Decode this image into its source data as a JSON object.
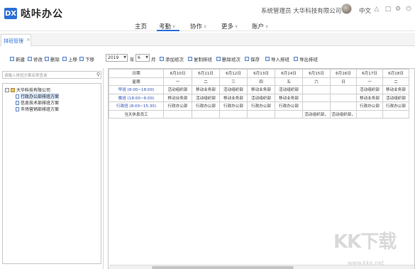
{
  "app": {
    "logo_mark": "DX",
    "title": "哒咔办公"
  },
  "header": {
    "user_role": "系统管理员 大华科技有限公司",
    "language": "中文",
    "nav": [
      {
        "label": "主页",
        "has_menu": false
      },
      {
        "label": "考勤",
        "has_menu": true,
        "active": true
      },
      {
        "label": "协作",
        "has_menu": true
      },
      {
        "label": "更多",
        "has_menu": true
      },
      {
        "label": "账户",
        "has_menu": true
      }
    ],
    "icons": [
      "bell-icon",
      "shirt-icon",
      "settings-icon",
      "power-icon"
    ],
    "accent": "#2b6fd6"
  },
  "tabs": [
    {
      "label": "排班管理",
      "close": "×"
    }
  ],
  "toolbar": {
    "left": [
      "新建",
      "修改",
      "删除",
      "上移",
      "下移"
    ],
    "year": "2019",
    "month": "6",
    "month_unit": "月",
    "actions": [
      "添加班次",
      "复制排班",
      "删除班次",
      "保存",
      "导入排班",
      "导出排班"
    ]
  },
  "search": {
    "placeholder": "请输入排班方案名称查询"
  },
  "tree": {
    "root": "大华科技有限公司",
    "children": [
      "行政办公部排班方案",
      "信息技术部排班方案",
      "市场营销部排班方案"
    ]
  },
  "schedule": {
    "header_date_label": "日期",
    "header_week_label": "星期",
    "dates": [
      "6月10日",
      "6月11日",
      "6月12日",
      "6月13日",
      "6月14日",
      "6月15日",
      "6月16日",
      "6月17日",
      "6月18日"
    ],
    "weekdays": [
      "一",
      "二",
      "三",
      "四",
      "五",
      "六",
      "日",
      "一",
      "二"
    ],
    "rows": [
      {
        "shift": "早班 (8:00~18:00)",
        "cells": [
          "活动组织部",
          "移动业务部",
          "活动组织部",
          "移动业务部",
          "活动组织部",
          "",
          "",
          "活动组织部",
          "移动业务部"
        ]
      },
      {
        "shift": "晚班 (18:00~6:00)",
        "cells": [
          "移动业务部",
          "活动组织部",
          "移动业务部",
          "活动组织部",
          "移动业务部",
          "",
          "",
          "移动业务部",
          "活动组织部"
        ]
      },
      {
        "shift": "行政班 (8:00~15:30)",
        "cells": [
          "行政办公部",
          "行政办公部",
          "行政办公部",
          "行政办公部",
          "行政办公部",
          "",
          "",
          "行政办公部",
          "行政办公部"
        ]
      },
      {
        "shift": "当天休息员工",
        "cells": [
          "",
          "",
          "",
          "",
          "",
          "活动组织部，",
          "活动组织部，",
          "",
          ""
        ]
      }
    ]
  },
  "watermark": {
    "brand": "KK下载",
    "url": "www.kkx.net"
  }
}
